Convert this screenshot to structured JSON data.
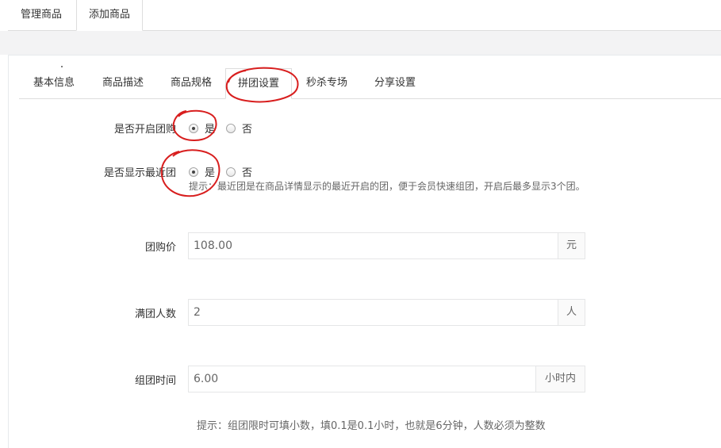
{
  "top_tabs": [
    "管理商品",
    "添加商品"
  ],
  "inner_tabs": [
    "基本信息",
    "商品描述",
    "商品规格",
    "拼团设置",
    "秒杀专场",
    "分享设置"
  ],
  "form": {
    "group_buy": {
      "label": "是否开启团购",
      "yes": "是",
      "no": "否",
      "selected": "是"
    },
    "show_recent": {
      "label": "是否显示最近团",
      "yes": "是",
      "no": "否",
      "selected": "是",
      "hint": "提示：最近团是在商品详情显示的最近开启的团，便于会员快速组团，开启后最多显示3个团。"
    },
    "group_price": {
      "label": "团购价",
      "value": "108.00",
      "unit": "元"
    },
    "group_size": {
      "label": "满团人数",
      "value": "2",
      "unit": "人"
    },
    "group_time": {
      "label": "组团时间",
      "value": "6.00",
      "unit": "小时内"
    },
    "bottom_hint": "提示：组团限时可填小数，填0.1是0.1小时，也就是6分钟，人数必须为整数"
  },
  "colors": {
    "annotation": "#d81e1e",
    "border": "#e5e6e7",
    "band": "#f3f3f4"
  }
}
